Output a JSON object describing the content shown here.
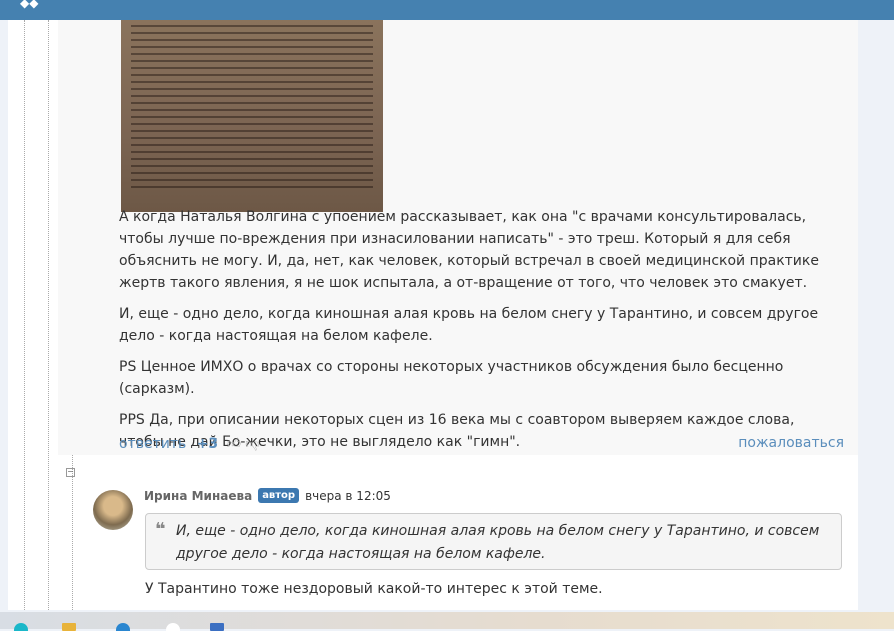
{
  "comment": {
    "paragraphs": [
      "А когда Наталья Волгина с упоением рассказывает, как она \"с врачами консультировалась, чтобы лучше по-вреждения при изнасиловании написать\" - это треш. Который я для себя объяснить не могу. И, да, нет, как человек, который встречал в своей медицинской практике жертв такого явления, я не шок испытала, а от-вращение от того, что человек это смакует.",
      "И, еще - одно дело, когда киношная  алая кровь на белом снегу у Тарантино, и совсем другое дело - когда настоящая на белом кафеле.",
      "PS  Ценное ИМХО о врачах со стороны некоторых участников обсуждения  было бесценно (сарказм).",
      "PPS  Да, при описании некоторых сцен из 16 века мы с соавтором выверяем каждое слова, чтобы не дай Бо-жечки, это не выглядело как \"гимн\"."
    ],
    "reply_label": "ответить",
    "rating": "+3",
    "report_label": "пожаловаться"
  },
  "reply_comment": {
    "collapse": "−",
    "author": "Ирина Минаева",
    "badge": "автор",
    "time": "вчера в 12:05",
    "quote": "И, еще - одно дело, когда киношная  алая кровь на белом снегу у Тарантино, и совсем другое дело - когда настоящая на белом кафеле.",
    "text": "У Тарантино тоже нездоровый какой-то интерес к этой теме."
  }
}
